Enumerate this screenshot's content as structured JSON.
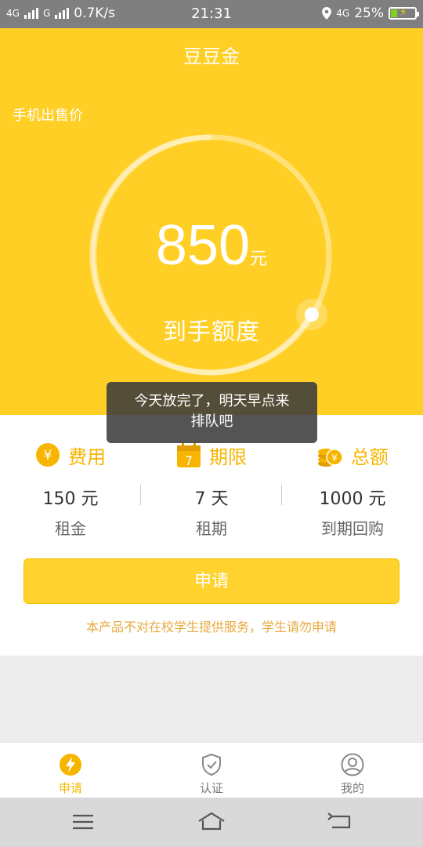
{
  "status_bar": {
    "net1": "4G",
    "net2": "G",
    "speed": "0.7K/s",
    "time": "21:31",
    "net3": "4G",
    "battery": "25%",
    "battery_level": 0.25
  },
  "header": {
    "title": "豆豆金",
    "subtitle": "手机出售价",
    "amount": "850",
    "amount_unit": "元",
    "amount_label": "到手额度"
  },
  "toast": {
    "line1": "今天放完了，明天早点来",
    "line2": "排队吧"
  },
  "stats": [
    {
      "icon": "yen-coin-icon",
      "title": "费用",
      "value": "150 元",
      "label": "租金"
    },
    {
      "icon": "calendar-icon",
      "title": "期限",
      "value": "7 天",
      "label": "租期"
    },
    {
      "icon": "coin-stack-icon",
      "title": "总额",
      "value": "1000 元",
      "label": "到期回购"
    }
  ],
  "apply_button": "申请",
  "notice": "本产品不对在校学生提供服务，学生请勿申请",
  "tabs": [
    {
      "label": "申请",
      "icon": "lightning-icon",
      "active": true
    },
    {
      "label": "认证",
      "icon": "shield-check-icon",
      "active": false
    },
    {
      "label": "我的",
      "icon": "user-icon",
      "active": false
    }
  ],
  "calendar_day": "7",
  "colors": {
    "brand_yellow": "#ffcf26",
    "accent": "#f7b500",
    "notice": "#e8a93f"
  }
}
